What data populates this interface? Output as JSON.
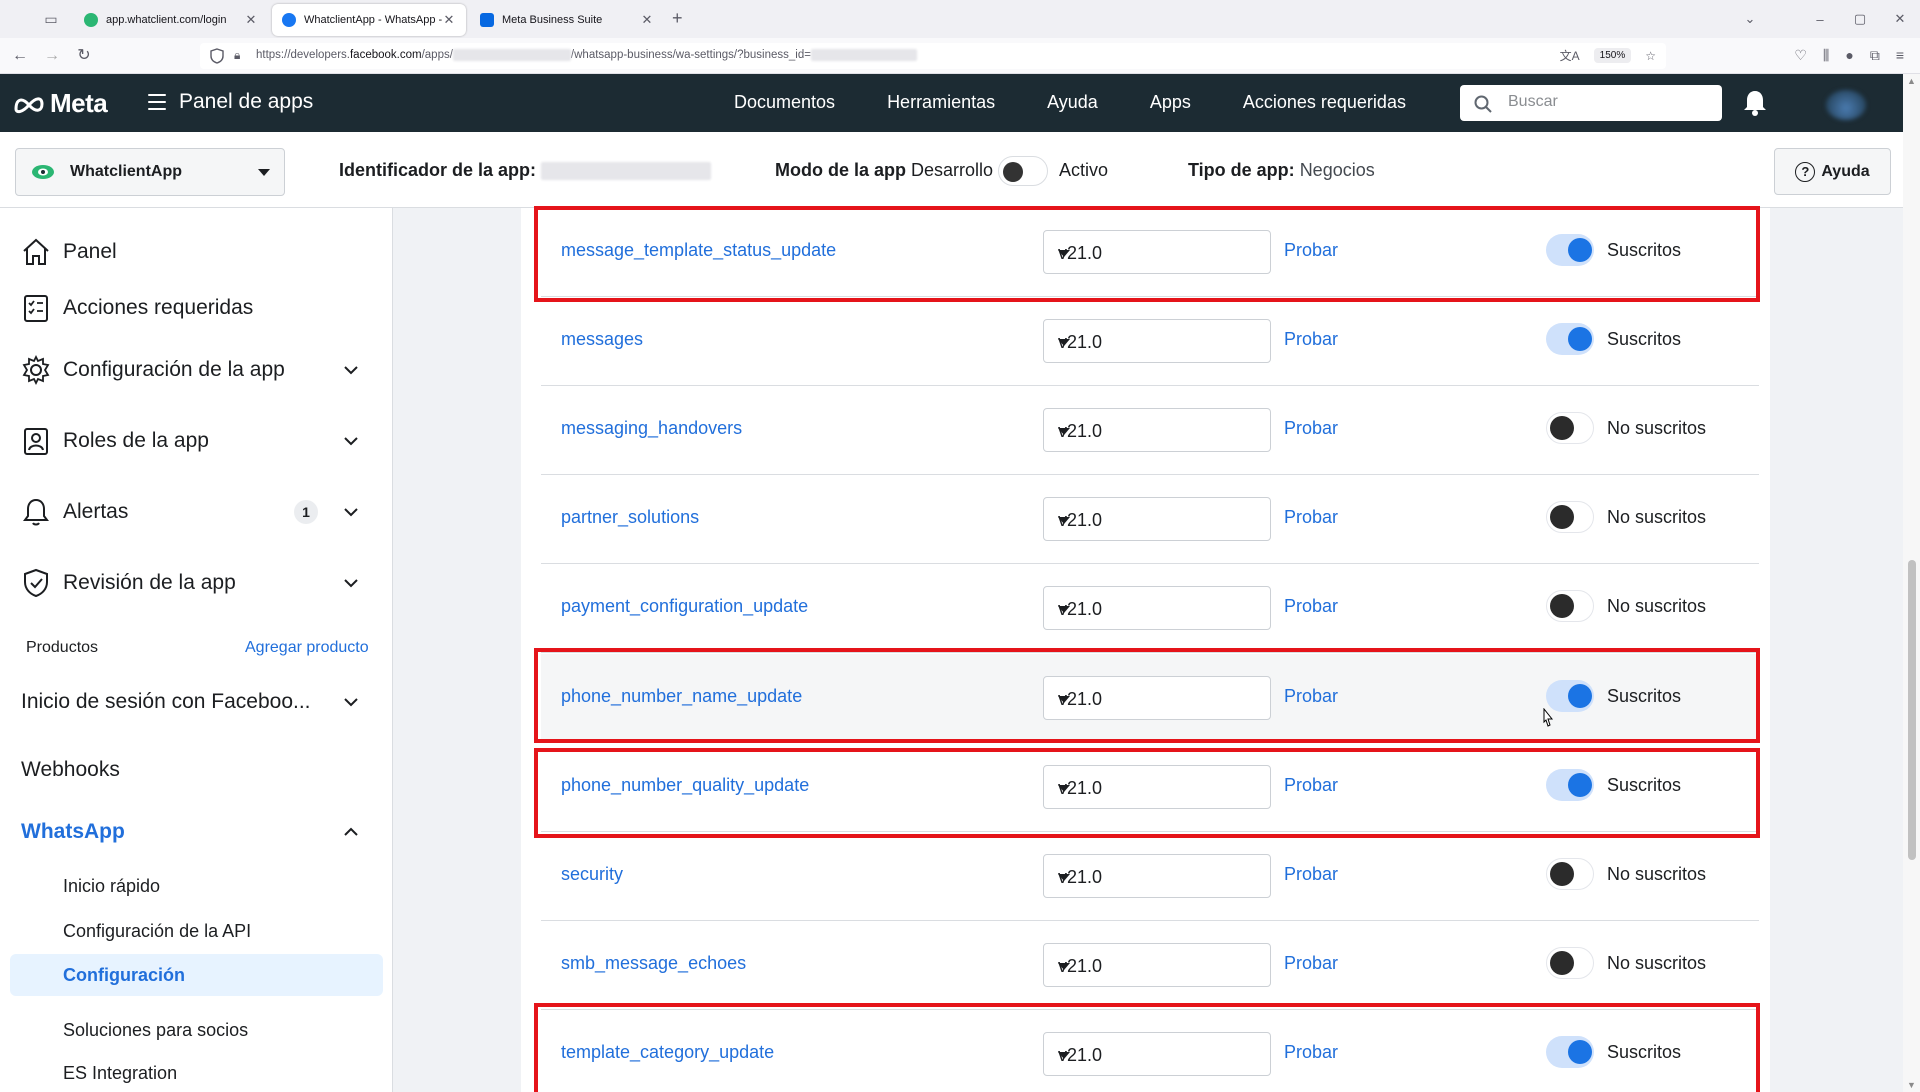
{
  "browser": {
    "tabs": [
      {
        "title": "app.whatclient.com/login",
        "active": false
      },
      {
        "title": "WhatclientApp - WhatsApp - M",
        "active": true
      },
      {
        "title": "Meta Business Suite",
        "active": false
      }
    ],
    "url_prefix": "https://developers.",
    "url_domain": "facebook.com",
    "url_path1": "/apps/",
    "url_path2": "/whatsapp-business/wa-settings/?business_id=",
    "zoom": "150%"
  },
  "header": {
    "logo_text": "Meta",
    "panel_title": "Panel de apps",
    "nav": [
      "Documentos",
      "Herramientas",
      "Ayuda",
      "Apps",
      "Acciones requeridas"
    ],
    "search_placeholder": "Buscar"
  },
  "appbar": {
    "app_name": "WhatclientApp",
    "app_id_label": "Identificador de la app:",
    "mode_label": "Modo de la app",
    "mode_dev": "Desarrollo",
    "mode_active": "Activo",
    "type_label": "Tipo de app:",
    "type_value": "Negocios",
    "help_label": "Ayuda"
  },
  "sidebar": {
    "items": [
      {
        "label": "Panel",
        "icon": "home-icon"
      },
      {
        "label": "Acciones requeridas",
        "icon": "checklist-icon"
      },
      {
        "label": "Configuración de la app",
        "icon": "gear-icon"
      },
      {
        "label": "Roles de la app",
        "icon": "roles-icon"
      },
      {
        "label": "Alertas",
        "icon": "bell-icon",
        "badge": "1"
      },
      {
        "label": "Revisión de la app",
        "icon": "shield-check-icon"
      }
    ],
    "products_label": "Productos",
    "add_product": "Agregar producto",
    "facebook_login": "Inicio de sesión con Faceboo...",
    "webhooks": "Webhooks",
    "whatsapp": "WhatsApp",
    "whatsapp_sub": [
      "Inicio rápido",
      "Configuración de la API",
      "Configuración",
      "Soluciones para socios",
      "ES Integration"
    ]
  },
  "webhook_fields": {
    "test_label": "Probar",
    "subscribed_label": "Suscritos",
    "unsubscribed_label": "No suscritos",
    "rows": [
      {
        "name": "message_template_status_update",
        "version": "v21.0",
        "subscribed": true
      },
      {
        "name": "messages",
        "version": "v21.0",
        "subscribed": true
      },
      {
        "name": "messaging_handovers",
        "version": "v21.0",
        "subscribed": false
      },
      {
        "name": "partner_solutions",
        "version": "v21.0",
        "subscribed": false
      },
      {
        "name": "payment_configuration_update",
        "version": "v21.0",
        "subscribed": false
      },
      {
        "name": "phone_number_name_update",
        "version": "v21.0",
        "subscribed": true
      },
      {
        "name": "phone_number_quality_update",
        "version": "v21.0",
        "subscribed": true
      },
      {
        "name": "security",
        "version": "v21.0",
        "subscribed": false
      },
      {
        "name": "smb_message_echoes",
        "version": "v21.0",
        "subscribed": false
      },
      {
        "name": "template_category_update",
        "version": "v21.0",
        "subscribed": true
      }
    ]
  },
  "colors": {
    "header_bg": "#1c2b33",
    "link_blue": "#216fdb",
    "toggle_on": "#1b74e4",
    "highlight_red": "#e5141a"
  }
}
